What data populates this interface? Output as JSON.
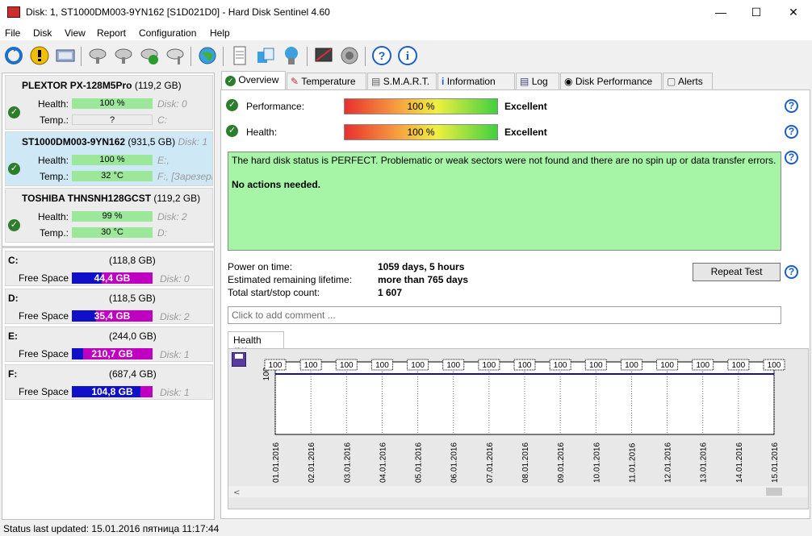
{
  "window": {
    "title": "Disk: 1, ST1000DM003-9YN162 [S1D021D0]  -  Hard Disk Sentinel 4.60"
  },
  "menu": [
    "File",
    "Disk",
    "View",
    "Report",
    "Configuration",
    "Help"
  ],
  "disks": [
    {
      "name": "PLEXTOR PX-128M5Pro",
      "size": "(119,2 GB)",
      "sub": "",
      "health": "100 %",
      "health_pct": 100,
      "temp": "?",
      "disk_ref": "Disk: 0",
      "drive": "C:"
    },
    {
      "name": "ST1000DM003-9YN162",
      "size": "(931,5 GB)",
      "sub": "Disk: 1",
      "health": "100 %",
      "health_pct": 100,
      "temp": "32 °C",
      "disk_ref": "E:,",
      "drive": "F:, [Зарезерв"
    },
    {
      "name": "TOSHIBA THNSNH128GCST",
      "size": "(119,2 GB)",
      "sub": "",
      "health": "99 %",
      "health_pct": 99,
      "temp": "30 °C",
      "disk_ref": "Disk: 2",
      "drive": "D:"
    }
  ],
  "labels": {
    "health": "Health:",
    "temp": "Temp.:",
    "free_space": "Free Space"
  },
  "volumes": [
    {
      "letter": "C:",
      "size": "(118,8 GB)",
      "free": "44,4 GB",
      "free_frac": 0.374,
      "disk": "Disk: 0"
    },
    {
      "letter": "D:",
      "size": "(118,5 GB)",
      "free": "35,4 GB",
      "free_frac": 0.299,
      "disk": "Disk: 2"
    },
    {
      "letter": "E:",
      "size": "(244,0 GB)",
      "free": "210,7 GB",
      "free_frac": 0.136,
      "disk": "Disk: 1"
    },
    {
      "letter": "F:",
      "size": "(687,4 GB)",
      "free": "104,8 GB",
      "free_frac": 0.848,
      "disk": "Disk: 1"
    }
  ],
  "tabs": [
    "Overview",
    "Temperature",
    "S.M.A.R.T.",
    "Information",
    "Log",
    "Disk Performance",
    "Alerts"
  ],
  "overview": {
    "performance_label": "Performance:",
    "performance_value": "100 %",
    "performance_rating": "Excellent",
    "health_label": "Health:",
    "health_value": "100 %",
    "health_rating": "Excellent",
    "status_text": "The hard disk status is PERFECT. Problematic or weak sectors were not found and there are no spin up or data transfer errors.",
    "status_action": "No actions needed.",
    "power_on_label": "Power on time:",
    "power_on_value": "1059 days, 5 hours",
    "lifetime_label": "Estimated remaining lifetime:",
    "lifetime_value": "more than 765 days",
    "startstop_label": "Total start/stop count:",
    "startstop_value": "1 607",
    "repeat_button": "Repeat Test",
    "comment_placeholder": "Click to add comment ..."
  },
  "chart_data": {
    "type": "line",
    "tab_label": "Health (%)",
    "ylabel_tick": "100",
    "categories": [
      "01.01.2016",
      "02.01.2016",
      "03.01.2016",
      "04.01.2016",
      "05.01.2016",
      "06.01.2016",
      "07.01.2016",
      "08.01.2016",
      "09.01.2016",
      "10.01.2016",
      "11.01.2016",
      "12.01.2016",
      "13.01.2016",
      "14.01.2016",
      "15.01.2016"
    ],
    "series": [
      {
        "values": [
          100,
          100,
          100,
          100,
          100,
          100,
          100,
          100,
          100,
          100,
          100,
          100,
          100,
          100,
          100
        ]
      }
    ],
    "line_color": "#1010a0"
  },
  "statusbar": {
    "text": "Status last updated: 15.01.2016 пятница 11:17:44"
  }
}
